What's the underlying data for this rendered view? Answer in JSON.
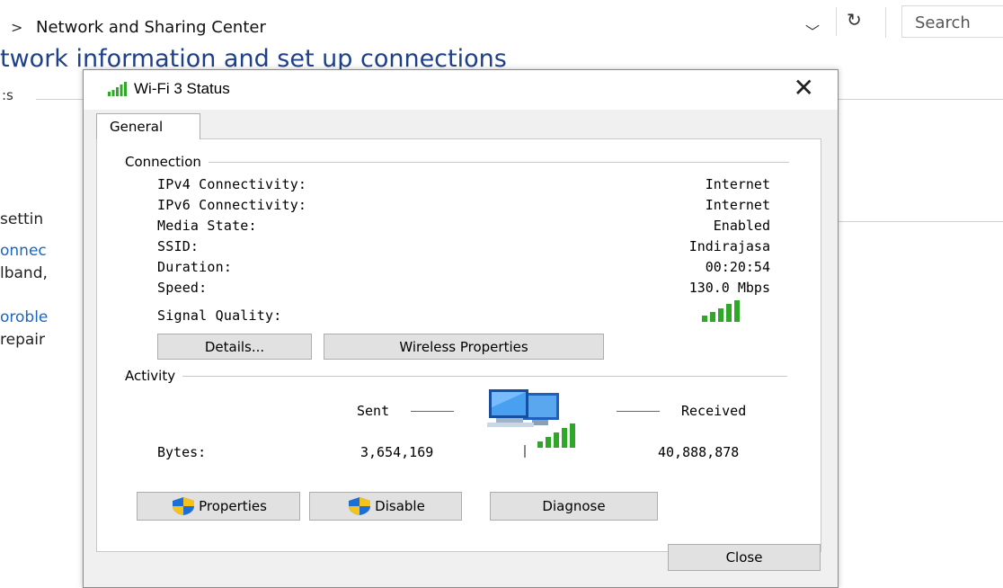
{
  "explorer": {
    "address_chevron": ">",
    "address_text": "Network and Sharing Center",
    "search_placeholder": "Search",
    "heading": "twork information and set up connections",
    "section_fragment": ":s",
    "paren_fragment": ")",
    "left_fragments": [
      {
        "text": "settin",
        "style": "plain"
      },
      {
        "text": "onnec",
        "style": "link"
      },
      {
        "text": "lband,",
        "style": "plain"
      },
      {
        "text": "oroble",
        "style": "link"
      },
      {
        "text": "repair",
        "style": "plain"
      }
    ]
  },
  "dialog": {
    "title": "Wi-Fi 3 Status",
    "close_glyph": "✕",
    "tab_label": "General",
    "connection": {
      "group_label": "Connection",
      "rows": [
        {
          "label": "IPv4 Connectivity:",
          "value": "Internet"
        },
        {
          "label": "IPv6 Connectivity:",
          "value": "Internet"
        },
        {
          "label": "Media State:",
          "value": "Enabled"
        },
        {
          "label": "SSID:",
          "value": "Indirajasa"
        },
        {
          "label": "Duration:",
          "value": "00:20:54"
        },
        {
          "label": "Speed:",
          "value": "130.0 Mbps"
        }
      ],
      "signal_label": "Signal Quality:",
      "signal_bars": 5
    },
    "buttons": {
      "details": "Details...",
      "wireless_properties": "Wireless Properties",
      "properties": "Properties",
      "disable": "Disable",
      "diagnose": "Diagnose",
      "close": "Close"
    },
    "activity": {
      "group_label": "Activity",
      "sent_label": "Sent",
      "received_label": "Received",
      "bytes_label": "Bytes:",
      "bytes_sent": "3,654,169",
      "bytes_received": "40,888,878"
    }
  },
  "colors": {
    "signal_green": "#2fa829",
    "heading_blue": "#1e3f8a",
    "link_blue": "#1a66c4",
    "shield_blue": "#1d6fd6",
    "shield_yellow": "#f4c21b"
  },
  "icons": [
    "chevron-right-icon",
    "chevron-down-icon",
    "refresh-icon",
    "wifi-signal-icon",
    "close-icon",
    "uac-shield-icon",
    "network-computers-icon"
  ]
}
